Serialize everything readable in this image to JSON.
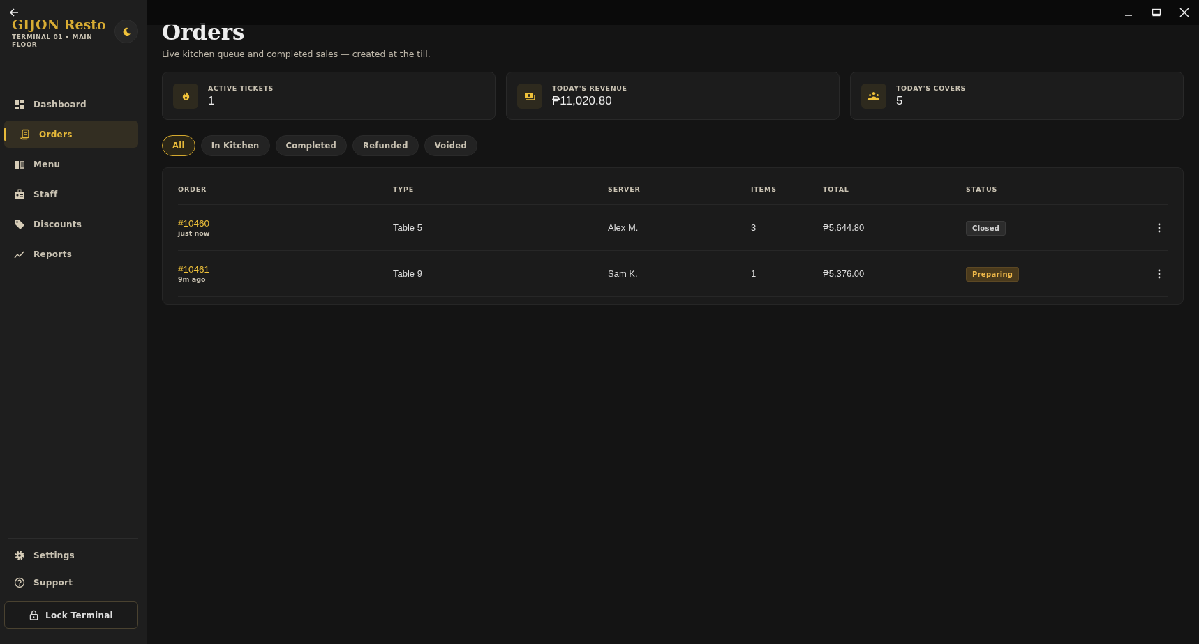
{
  "brand": {
    "name": "GIJON Resto",
    "subtitle": "TERMINAL 01 • MAIN FLOOR"
  },
  "sidebar": {
    "items": [
      {
        "label": "Dashboard",
        "selected": false
      },
      {
        "label": "Orders",
        "selected": true
      },
      {
        "label": "Menu",
        "selected": false
      },
      {
        "label": "Staff",
        "selected": false
      },
      {
        "label": "Discounts",
        "selected": false
      },
      {
        "label": "Reports",
        "selected": false
      }
    ],
    "bottom_items": [
      {
        "label": "Settings",
        "selected": false
      },
      {
        "label": "Support",
        "selected": false
      }
    ],
    "lock_button": "Lock Terminal"
  },
  "page": {
    "title": "Orders",
    "subtitle": "Live kitchen queue and completed sales — created at the till."
  },
  "stats": [
    {
      "label": "ACTIVE TICKETS",
      "value": "1"
    },
    {
      "label": "TODAY'S REVENUE",
      "value": "₱11,020.80"
    },
    {
      "label": "TODAY'S COVERS",
      "value": "5"
    }
  ],
  "filters": [
    {
      "label": "All",
      "selected": true
    },
    {
      "label": "In Kitchen",
      "selected": false
    },
    {
      "label": "Completed",
      "selected": false
    },
    {
      "label": "Refunded",
      "selected": false
    },
    {
      "label": "Voided",
      "selected": false
    }
  ],
  "table": {
    "columns": [
      "ORDER",
      "TYPE",
      "SERVER",
      "ITEMS",
      "TOTAL",
      "STATUS"
    ],
    "rows": [
      {
        "order": "#10460",
        "time": "just now",
        "type": "Table 5",
        "server": "Alex M.",
        "items": "3",
        "total": "₱5,644.80",
        "status": "Closed",
        "kind": "closed"
      },
      {
        "order": "#10461",
        "time": "9m ago",
        "type": "Table 9",
        "server": "Sam K.",
        "items": "1",
        "total": "₱5,376.00",
        "status": "Preparing",
        "kind": "preparing"
      }
    ]
  }
}
